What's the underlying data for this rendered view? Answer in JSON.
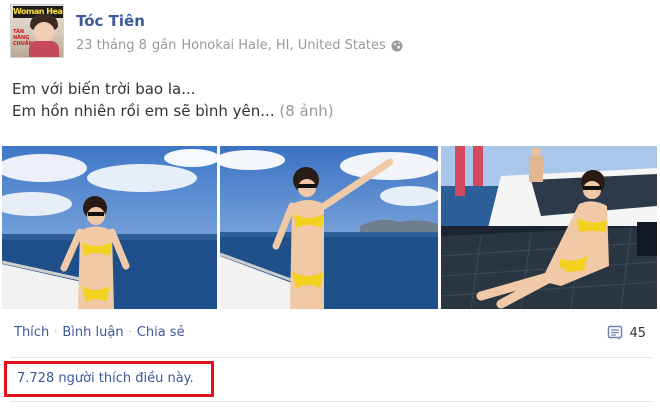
{
  "post": {
    "author": "Tóc Tiên",
    "avatar_masthead": "Woman Health",
    "avatar_cover_text": "TÂN NĂNG CHUẨN",
    "date": "23 tháng 8",
    "location_prefix": "gần",
    "location": "Honokai Hale, HI, United States",
    "text_line1": "Em với biến trời bao la...",
    "text_line2": "Em hồn nhiên rồi em sẽ bình yên...",
    "photo_count_label": "(8 ảnh)",
    "icons": [
      "globe-icon",
      "comment-icon"
    ]
  },
  "actions": {
    "like": "Thích",
    "comment": "Bình luận",
    "share": "Chia sẻ",
    "separator": "·"
  },
  "stats": {
    "comment_count": "45",
    "likes_text": "7.728 người thích điều này."
  },
  "colors": {
    "link": "#3b5998",
    "meta": "#999999",
    "highlight_box": "#e0101a",
    "sky": "#5d8fd0",
    "sea": "#1f4f86",
    "bikini": "#f2d21e"
  }
}
